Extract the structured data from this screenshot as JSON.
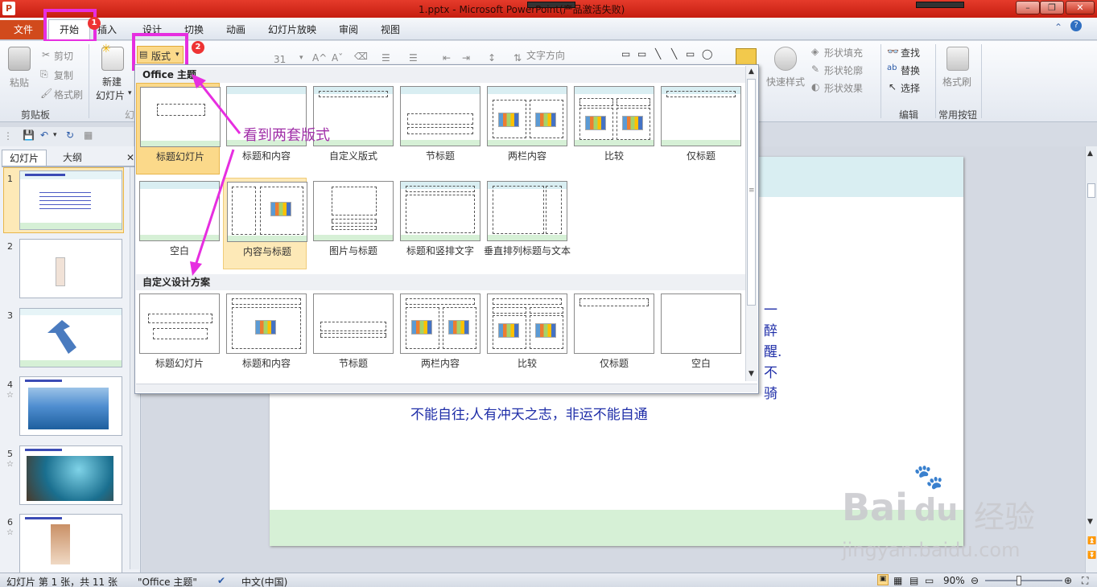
{
  "window": {
    "title": "1.pptx - Microsoft PowerPoint(产品激活失败)",
    "app_logo": "P",
    "buttons": [
      "–",
      "❐",
      "✕"
    ]
  },
  "tabs": {
    "file": "文件",
    "items": [
      "开始",
      "插入",
      "设计",
      "切换",
      "动画",
      "幻灯片放映",
      "审阅",
      "视图"
    ]
  },
  "ribbon": {
    "paste": "粘贴",
    "cut": "剪切",
    "copy": "复制",
    "format_painter": "格式刷",
    "clipboard_group": "剪贴板",
    "new_slide_line1": "新建",
    "new_slide_line2": "幻灯片",
    "layout_button": "版式",
    "font_size": "31",
    "text_direction": "文字方向",
    "quick_styles": "快速样式",
    "shape_fill": "形状填充",
    "shape_outline": "形状轮廓",
    "shape_effects": "形状效果",
    "find": "查找",
    "replace": "替换",
    "select": "选择",
    "edit_group": "编辑",
    "format_brush_big": "格式刷",
    "common_group": "常用按钮"
  },
  "annotations": {
    "badge1": "1",
    "badge2": "2",
    "note": "看到两套版式"
  },
  "gallery": {
    "section1": "Office 主题",
    "section2": "自定义设计方案",
    "office_layouts": [
      "标题幻灯片",
      "标题和内容",
      "自定义版式",
      "节标题",
      "两栏内容",
      "比较",
      "仅标题",
      "空白",
      "内容与标题",
      "图片与标题",
      "标题和竖排文字",
      "垂直排列标题与文本"
    ],
    "custom_layouts": [
      "标题幻灯片",
      "标题和内容",
      "节标题",
      "两栏内容",
      "比较",
      "仅标题",
      "空白"
    ]
  },
  "left_panel": {
    "tab_slides": "幻灯片",
    "tab_outline": "大纲",
    "close": "✕",
    "slide_numbers": [
      "1",
      "2",
      "3",
      "4",
      "5",
      "6"
    ],
    "star": "☆"
  },
  "slide_text": [
    "一",
    "醉",
    "醒.",
    "不",
    "骑",
    "不能自往;人有冲天之志，非运不能自通"
  ],
  "status": {
    "slide_count": "幻灯片 第 1 张，共 11 张",
    "theme": "\"Office 主题\"",
    "language": "中文(中国)",
    "zoom": "90%"
  },
  "watermark": {
    "logo": "Bai",
    "logo2": "du",
    "cn": "经验",
    "url": "jingyan.baidu.com"
  },
  "colors": {
    "accent": "#c43e1c",
    "highlight": "#e62ee0",
    "selected": "#fbd98a",
    "slide_text": "#1f2ea8"
  }
}
